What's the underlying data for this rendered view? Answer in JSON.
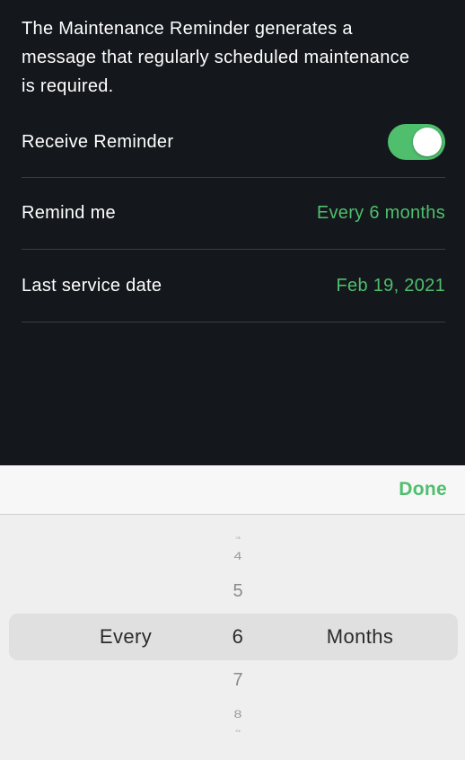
{
  "settings": {
    "description": "The Maintenance Reminder generates a message that regularly scheduled maintenance is required.",
    "receive_reminder": {
      "label": "Receive Reminder",
      "enabled": true
    },
    "remind_me": {
      "label": "Remind me",
      "value": "Every 6 months"
    },
    "last_service": {
      "label": "Last service date",
      "value": "Feb 19, 2021"
    }
  },
  "toolbar": {
    "done_label": "Done"
  },
  "picker": {
    "prefix": "Every",
    "suffix": "Months",
    "selected": "6",
    "above": [
      "3",
      "4",
      "5"
    ],
    "below": [
      "7",
      "8",
      "9"
    ]
  },
  "colors": {
    "accent": "#4fbf6e",
    "background": "#14171b",
    "picker_bg": "#efefef"
  }
}
